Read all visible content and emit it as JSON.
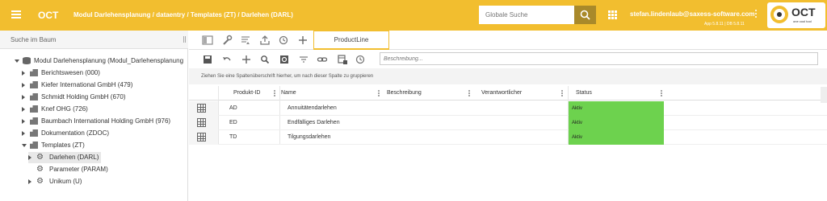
{
  "header": {
    "app_title": "OCT",
    "breadcrumb": "Modul Darlehensplanung / dataentry / Templates (ZT) / Darlehen (DARL)",
    "search_placeholder": "Globale Suche",
    "user_email": "stefan.lindenlaub@saxess-software.com",
    "version": "App 5.8.11 | DB 5.8.11",
    "logo_text": "OCT",
    "logo_sub": "one cool tool",
    "background_color": "#f2be2f"
  },
  "tree": {
    "search_label": "Suche im Baum",
    "root": "Modul Darlehensplanung (Modul_Darlehensplanung",
    "items": [
      "Berichtswesen (000)",
      "Kiefer International GmbH (479)",
      "Schmidt Holding GmbH (670)",
      "Knef OHG (726)",
      "Baumbach International Holding GmbH (976)",
      "Dokumentation (ZDOC)",
      "Templates (ZT)"
    ],
    "children": [
      "Darlehen (DARL)",
      "Parameter (PARAM)",
      "Unikum (U)"
    ]
  },
  "main": {
    "tab_label": "ProductLine",
    "description_placeholder": "Beschreibung...",
    "group_hint": "Ziehen Sie eine Spaltenüberschrift hierher, um nach dieser Spalte zu gruppieren",
    "columns": [
      "Produkt-ID",
      "Name",
      "Beschreibung",
      "Verantwortlicher",
      "Status"
    ],
    "rows": [
      {
        "id": "AD",
        "name": "Annuitätendarlehen",
        "description": "",
        "owner": "",
        "status": "Aktiv"
      },
      {
        "id": "ED",
        "name": "Endfälliges Darlehen",
        "description": "",
        "owner": "",
        "status": "Aktiv"
      },
      {
        "id": "TD",
        "name": "Tilgungsdarlehen",
        "description": "",
        "owner": "",
        "status": "Aktiv"
      }
    ],
    "status_color": "#6dd24e"
  }
}
